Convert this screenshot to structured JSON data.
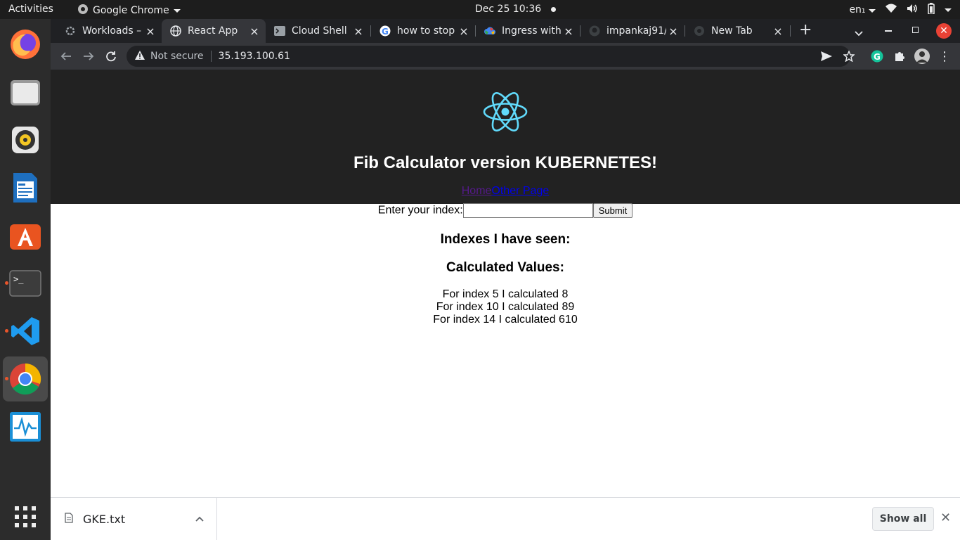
{
  "topbar": {
    "activities": "Activities",
    "app_name": "Google Chrome",
    "datetime": "Dec 25  10:36",
    "language": "en₁"
  },
  "dock": {
    "items": [
      "firefox-icon",
      "files-icon",
      "rhythmbox-icon",
      "libreoffice-writer-icon",
      "software-center-icon",
      "terminal-icon",
      "vscode-icon",
      "chrome-icon",
      "system-monitor-icon",
      "app-grid-icon"
    ]
  },
  "tabs": [
    {
      "title": "Workloads –",
      "active": false
    },
    {
      "title": "React App",
      "active": true
    },
    {
      "title": "Cloud Shell",
      "active": false
    },
    {
      "title": "how to stop",
      "active": false
    },
    {
      "title": "Ingress with",
      "active": false
    },
    {
      "title": "impankaj91/",
      "active": false
    },
    {
      "title": "New Tab",
      "active": false
    }
  ],
  "omnibox": {
    "security": "Not secure",
    "url": "35.193.100.61"
  },
  "app": {
    "title": "Fib Calculator version KUBERNETES!",
    "link_home": "Home",
    "link_other": "Other Page",
    "input_label": "Enter your index:",
    "submit_label": "Submit",
    "indexes_heading": "Indexes I have seen:",
    "values_heading": "Calculated Values:",
    "values": [
      "For index 5 I calculated 8",
      "For index 10 I calculated 89",
      "For index 14 I calculated 610"
    ]
  },
  "downloads": {
    "file_name": "GKE.txt",
    "show_all": "Show all"
  }
}
